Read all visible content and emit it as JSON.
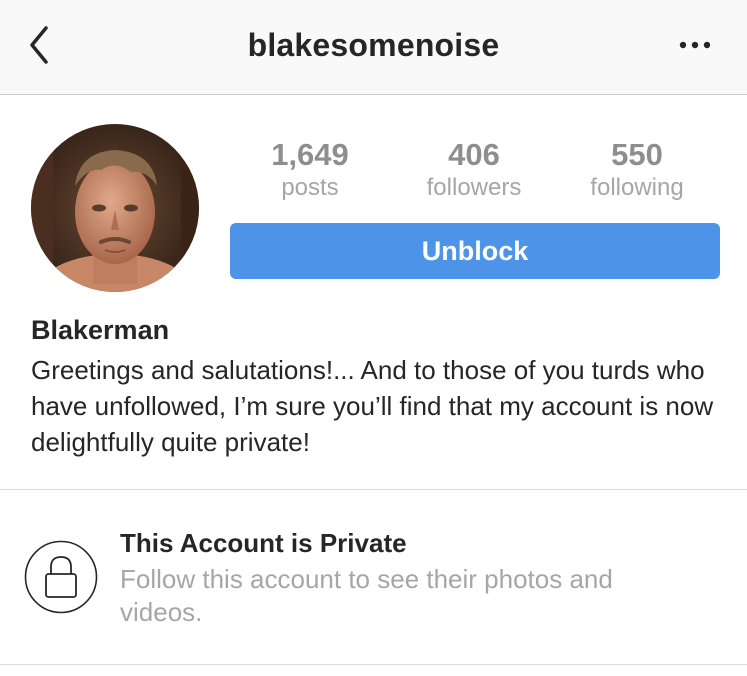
{
  "navbar": {
    "title": "blakesomenoise",
    "back_icon": "chevron-left-icon",
    "more_icon": "more-horizontal-icon"
  },
  "profile": {
    "avatar_icon": "profile-photo",
    "stats": {
      "posts": {
        "value": "1,649",
        "label": "posts"
      },
      "followers": {
        "value": "406",
        "label": "followers"
      },
      "following": {
        "value": "550",
        "label": "following"
      }
    },
    "unblock_label": "Unblock",
    "display_name": "Blakerman",
    "bio": "Greetings and salutations!... And to those of you turds who have unfollowed, I’m sure you’ll find that my account is now delightfully quite private!"
  },
  "private_notice": {
    "icon": "lock-icon",
    "title": "This Account is Private",
    "description": "Follow this account to see their photos and videos."
  },
  "colors": {
    "accent": "#4d93e8",
    "text": "#262626",
    "muted": "#a6a6a6",
    "navbar_bg": "#f9f9f9"
  }
}
